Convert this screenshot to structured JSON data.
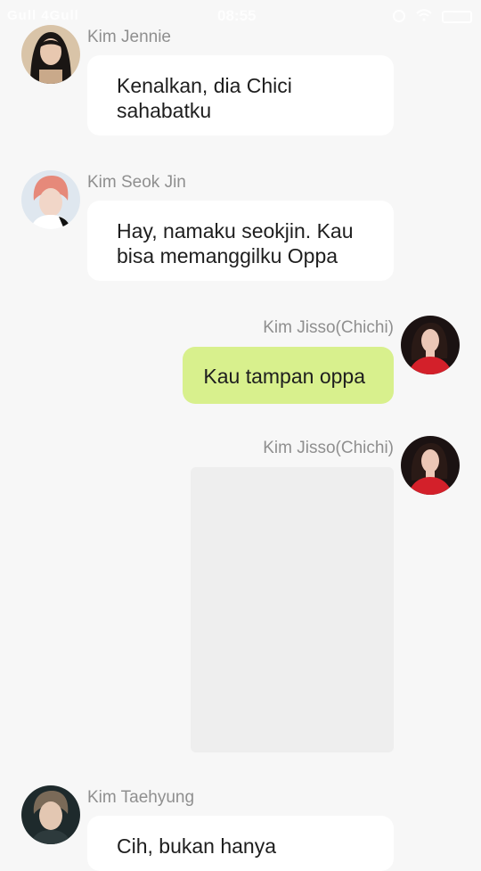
{
  "status_bar": {
    "carrier": "Gull 4Gull",
    "time": "08:55"
  },
  "messages": [
    {
      "sender": "Kim Jennie",
      "direction": "incoming",
      "text": "Kenalkan, dia Chici sahabatku",
      "avatar_colors": {
        "bg": "#d9c4a8",
        "hair": "#1a1614",
        "skin": "#e8c8b0"
      }
    },
    {
      "sender": "Kim Seok Jin",
      "direction": "incoming",
      "text": "Hay, namaku seokjin.  Kau bisa memanggilku Oppa",
      "avatar_colors": {
        "bg": "#dfe7ef",
        "hair": "#e6897a",
        "skin": "#f1d6c8"
      }
    },
    {
      "sender": "Kim Jisso(Chichi)",
      "direction": "outgoing",
      "text": "Kau tampan oppa",
      "avatar_colors": {
        "bg": "#1b1212",
        "hair": "#2a1a16",
        "skin": "#ecc7b6",
        "dress": "#d3202a"
      }
    },
    {
      "sender": "Kim Jisso(Chichi)",
      "direction": "outgoing",
      "type": "image",
      "avatar_colors": {
        "bg": "#1b1212",
        "hair": "#2a1a16",
        "skin": "#ecc7b6",
        "dress": "#d3202a"
      }
    },
    {
      "sender": "Kim Taehyung",
      "direction": "incoming",
      "text": "Cih, bukan hanya",
      "avatar_colors": {
        "bg": "#1e2a2c",
        "hair": "#7a6a58",
        "skin": "#e3c7b2"
      }
    }
  ],
  "colors": {
    "background": "#f7f7f7",
    "incoming_bubble": "#ffffff",
    "outgoing_bubble": "#d8f08d",
    "name_text": "#8f8f8f"
  }
}
